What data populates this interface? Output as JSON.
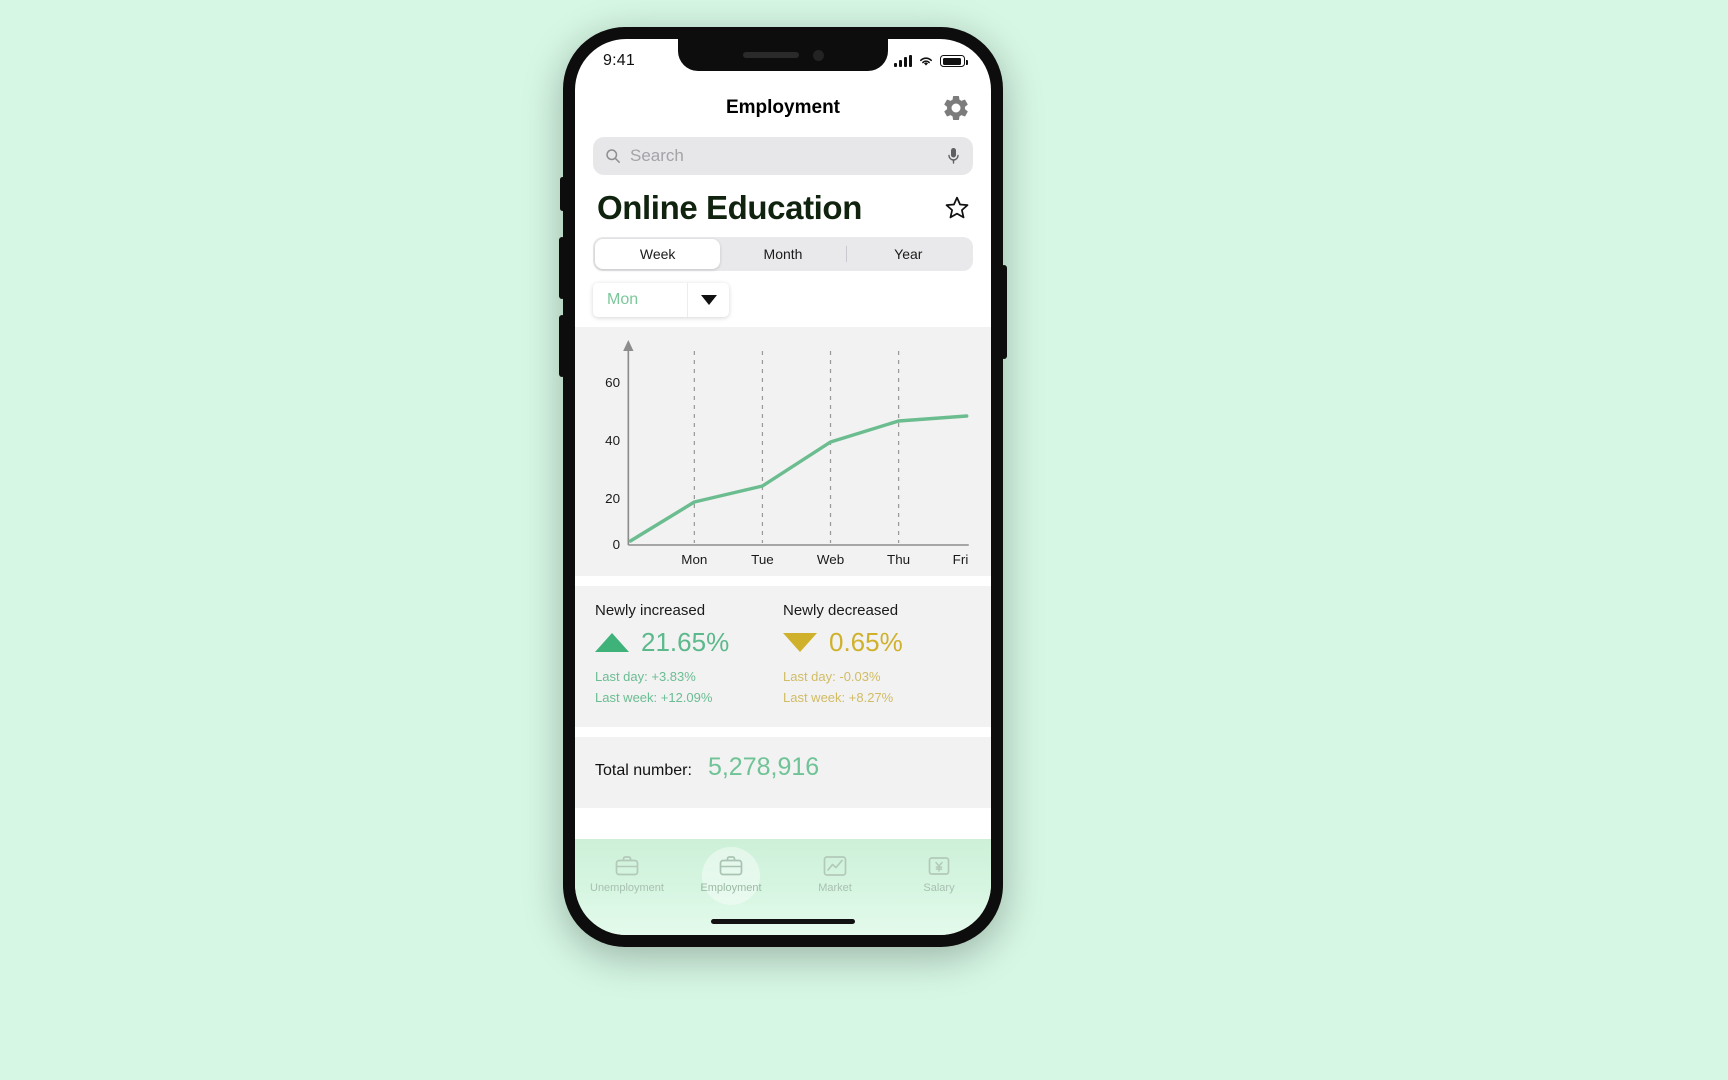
{
  "background_color": "#d6f7e4",
  "status_bar": {
    "time": "9:41",
    "signal_icon": "cellular-signal-icon",
    "wifi_icon": "wifi-icon",
    "battery_icon": "battery-icon"
  },
  "header": {
    "title": "Employment",
    "settings_icon": "gear-icon"
  },
  "search": {
    "placeholder": "Search",
    "search_icon": "search-icon",
    "mic_icon": "microphone-icon"
  },
  "page": {
    "title": "Online Education",
    "favorite_icon": "star-outline-icon"
  },
  "segmented_control": {
    "options": [
      "Week",
      "Month",
      "Year"
    ],
    "selected": "Week"
  },
  "dropdown": {
    "value": "Mon",
    "caret_icon": "chevron-down-icon"
  },
  "chart_data": {
    "type": "line",
    "title": "",
    "xlabel": "",
    "ylabel": "",
    "categories": [
      "Mon",
      "Tue",
      "Web",
      "Thu",
      "Fri"
    ],
    "x": [
      "Mon",
      "Tue",
      "Web",
      "Thu",
      "Fri"
    ],
    "values": [
      15,
      20.5,
      35.5,
      42.5,
      44.5
    ],
    "origin_value": 1.5,
    "series": [
      {
        "name": "Online Education",
        "values": [
          15,
          20.5,
          35.5,
          42.5,
          44.5
        ],
        "color": "#6bbd90"
      }
    ],
    "ytick_labels": [
      "0",
      "20",
      "40",
      "60"
    ],
    "yticks": [
      0,
      20,
      40,
      60
    ],
    "ylim": [
      0,
      70
    ],
    "grid": "vertical-dashed",
    "legend": "none",
    "line_color": "#6bbd90",
    "axis_color": "#8c8c8c",
    "plot_background": "#f2f2f2"
  },
  "stats": [
    {
      "label": "Newly increased",
      "direction": "up",
      "arrow_icon": "triangle-up-icon",
      "value": "21.65%",
      "last_day": "Last day: +3.83%",
      "last_week": "Last week: +12.09%",
      "color": "#5cb98c"
    },
    {
      "label": "Newly decreased",
      "direction": "down",
      "arrow_icon": "triangle-down-icon",
      "value": "0.65%",
      "last_day": "Last day: -0.03%",
      "last_week": "Last week: +8.27%",
      "color": "#cfb12c"
    }
  ],
  "total": {
    "label": "Total number:",
    "value": "5,278,916",
    "value_color": "#6fc396"
  },
  "tab_bar": {
    "items": [
      {
        "label": "Unemployment",
        "icon": "briefcase-icon",
        "active": false
      },
      {
        "label": "Employment",
        "icon": "briefcase-icon",
        "active": true
      },
      {
        "label": "Market",
        "icon": "chart-line-icon",
        "active": false
      },
      {
        "label": "Salary",
        "icon": "yen-bill-icon",
        "active": false
      }
    ]
  }
}
